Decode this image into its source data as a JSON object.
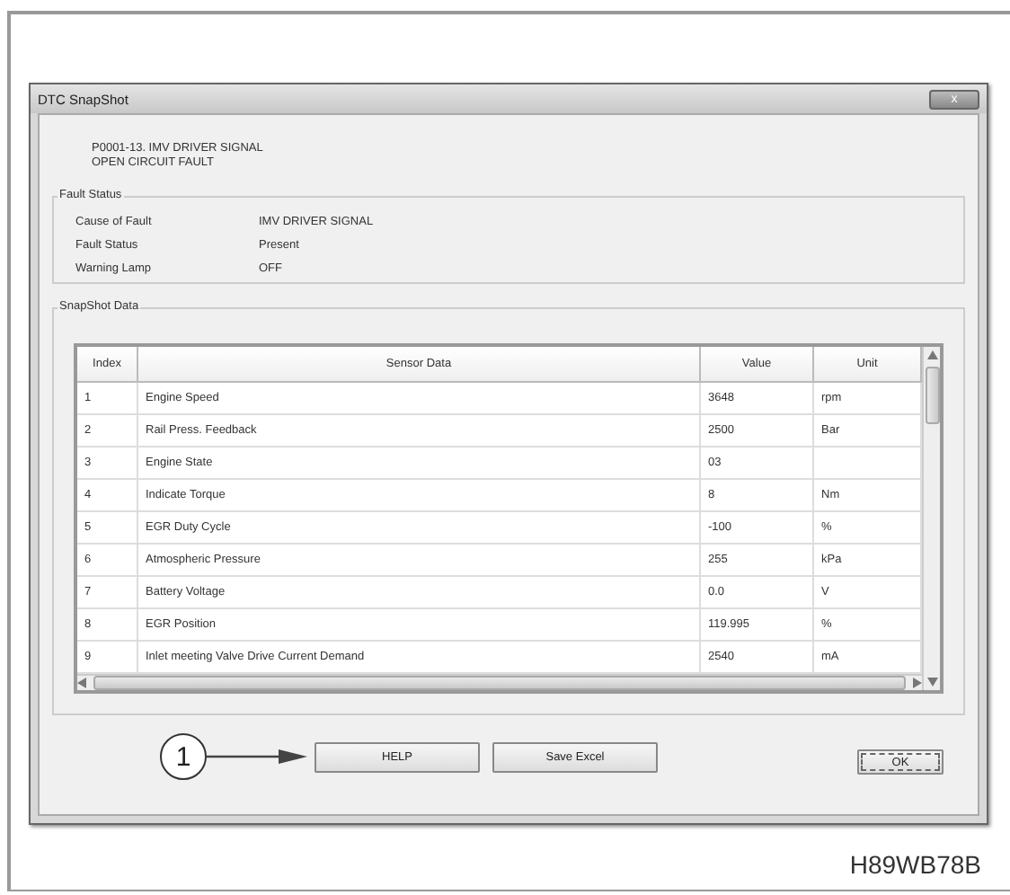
{
  "window": {
    "title": "DTC SnapShot",
    "close_label": "x"
  },
  "dtc": {
    "code_line": "P0001-13. IMV DRIVER SIGNAL",
    "description": "OPEN CIRCUIT FAULT"
  },
  "fault_status": {
    "title": "Fault Status",
    "rows": [
      {
        "label": "Cause of Fault",
        "value": "IMV DRIVER SIGNAL"
      },
      {
        "label": "Fault Status",
        "value": "Present"
      },
      {
        "label": "Warning Lamp",
        "value": "OFF"
      }
    ]
  },
  "snapshot": {
    "title": "SnapShot Data",
    "columns": [
      "Index",
      "Sensor Data",
      "Value",
      "Unit"
    ],
    "rows": [
      [
        "1",
        "Engine Speed",
        "3648",
        "rpm"
      ],
      [
        "2",
        "Rail Press. Feedback",
        "2500",
        "Bar"
      ],
      [
        "3",
        "Engine State",
        "03",
        ""
      ],
      [
        "4",
        "Indicate Torque",
        "8",
        "Nm"
      ],
      [
        "5",
        "EGR Duty Cycle",
        "-100",
        "%"
      ],
      [
        "6",
        "Atmospheric Pressure",
        "255",
        "kPa"
      ],
      [
        "7",
        "Battery Voltage",
        "0.0",
        "V"
      ],
      [
        "8",
        "EGR Position",
        "119.995",
        "%"
      ],
      [
        "9",
        "Inlet meeting Valve Drive Current Demand",
        "2540",
        "mA"
      ]
    ]
  },
  "buttons": [
    {
      "label": "HELP"
    },
    {
      "label": "Save Excel"
    }
  ],
  "ok_button": {
    "label": "OK"
  },
  "callout": {
    "number": "1"
  },
  "figure_code": "H89WB78B"
}
